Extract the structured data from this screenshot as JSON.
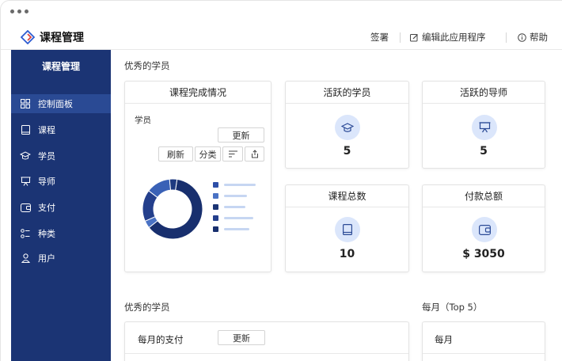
{
  "app": {
    "title": "课程管理"
  },
  "topbar": {
    "sign": "签署",
    "edit": "编辑此应用程序",
    "help": "帮助"
  },
  "sidebar": {
    "title": "课程管理",
    "items": [
      {
        "label": "控制面板",
        "icon": "dashboard-icon",
        "active": true
      },
      {
        "label": "课程",
        "icon": "book-icon"
      },
      {
        "label": "学员",
        "icon": "graduation-cap-icon"
      },
      {
        "label": "导师",
        "icon": "presentation-board-icon"
      },
      {
        "label": "支付",
        "icon": "wallet-icon"
      },
      {
        "label": "种类",
        "icon": "category-icon"
      },
      {
        "label": "用户",
        "icon": "user-icon"
      }
    ]
  },
  "sections": {
    "top_students": "优秀的学员",
    "top_students_2": "优秀的学员",
    "monthly_top5": "每月（Top 5）"
  },
  "completion_card": {
    "title": "课程完成情况",
    "subtitle": "学员",
    "update": "更新",
    "refresh": "刷新",
    "category": "分类",
    "donut": [
      {
        "value": 0.62,
        "color": "#182f6e"
      },
      {
        "value": 0.04,
        "color": "#4a72c4"
      },
      {
        "value": 0.17,
        "color": "#243f8c"
      },
      {
        "value": 0.13,
        "color": "#3a61b6"
      },
      {
        "value": 0.04,
        "color": "#1e3a80"
      }
    ],
    "legend_colors": [
      "#2d4fa8",
      "#4a72c4",
      "#1b3474",
      "#243f8c",
      "#182f6e"
    ]
  },
  "stats": {
    "active_students": {
      "title": "活跃的学员",
      "value": "5",
      "icon": "graduation-cap-icon"
    },
    "active_tutors": {
      "title": "活跃的导师",
      "value": "5",
      "icon": "presentation-board-icon"
    },
    "total_courses": {
      "title": "课程总数",
      "value": "10",
      "icon": "book-icon"
    },
    "total_payments": {
      "title": "付款总额",
      "value": "$ 3050",
      "icon": "wallet-icon"
    }
  },
  "monthly_payment": {
    "label": "每月的支付",
    "update": "更新"
  },
  "monthly": {
    "label": "每月"
  },
  "colors": {
    "sidebar": "#1b3474",
    "accent": "#2a4a94",
    "icon_bg": "#dbe6fb"
  }
}
